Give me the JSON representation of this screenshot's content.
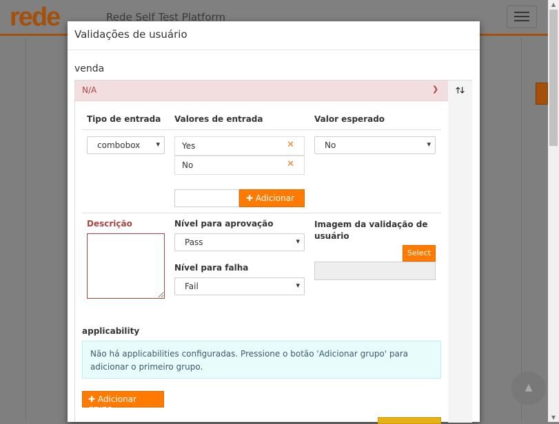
{
  "app": {
    "logo": "rede",
    "title": "Rede Self Test Platform"
  },
  "modal": {
    "title": "Validações de usuário",
    "section": "venda"
  },
  "panel": {
    "header": "N/A",
    "columns": {
      "input_type": "Tipo de entrada",
      "input_values": "Valores de entrada",
      "expected": "Valor esperado"
    },
    "input_type_value": "combobox",
    "input_values": [
      {
        "label": "Yes"
      },
      {
        "label": "No"
      }
    ],
    "new_value_placeholder": "",
    "add_label": "Adicionar",
    "expected_value": "No",
    "description_label": "Descrição",
    "approval_label": "Nível para aprovação",
    "approval_value": "Pass",
    "fail_label": "Nível para falha",
    "fail_value": "Fail",
    "image_label": "Imagem da validação de usuário",
    "select_label": "Select",
    "applicability_label": "applicability",
    "applicability_info": "Não há applicabilities configuradas. Pressione o botão 'Adicionar grupo' para adicionar o primeiro grupo.",
    "add_group_label": "Adicionar grupo"
  },
  "colors": {
    "accent": "#ff7a00",
    "brand": "#a4500b",
    "error": "#a94442"
  }
}
